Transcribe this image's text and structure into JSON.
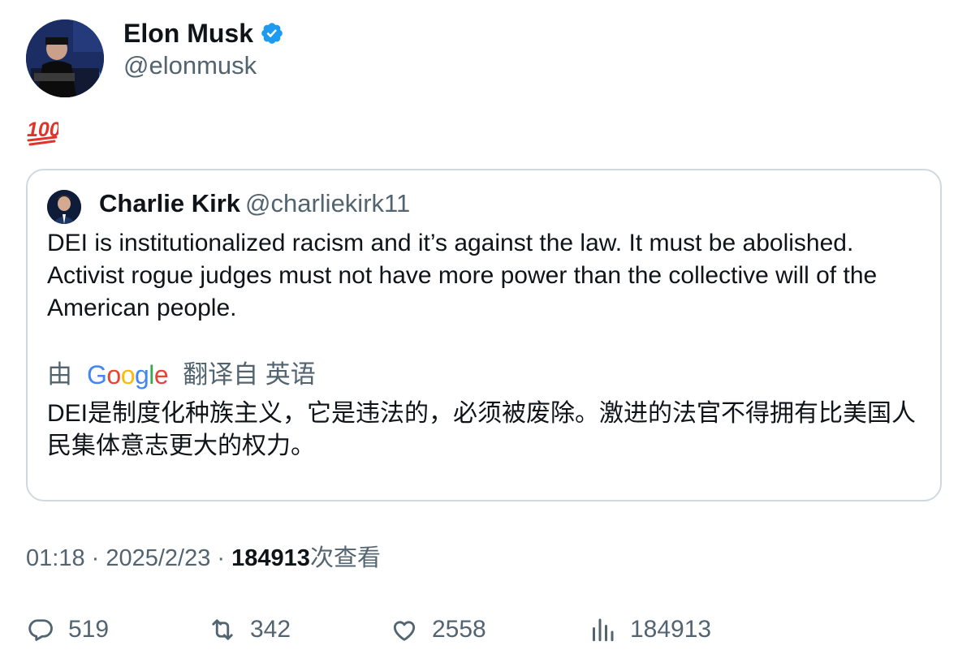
{
  "author": {
    "name": "Elon Musk",
    "handle": "@elonmusk",
    "verified": true,
    "badge_color": "#1d9bf0"
  },
  "post": {
    "emoji_icon": "hundred-points-emoji"
  },
  "quoted": {
    "name": "Charlie Kirk",
    "handle": "@charliekirk11",
    "text": "DEI is institutionalized racism and it’s against the law. It must be abolished. Activist rogue judges must not have more power than the collective will of the American people.",
    "translation": {
      "prefix": "由",
      "logo": {
        "G": "G",
        "o1": "o",
        "o2": "o",
        "g": "g",
        "l": "l",
        "e": "e"
      },
      "suffix": "翻译自 英语",
      "text": "DEI是制度化种族主义，它是违法的，必须被废除。激进的法官不得拥有比美国人民集体意志更大的权力。"
    }
  },
  "meta": {
    "time": "01:18",
    "sep1": " · ",
    "date": "2025/2/23",
    "sep2": " · ",
    "views": "184913",
    "views_suffix": "次查看"
  },
  "actions": {
    "replies": "519",
    "reposts": "342",
    "likes": "2558",
    "views": "184913"
  }
}
